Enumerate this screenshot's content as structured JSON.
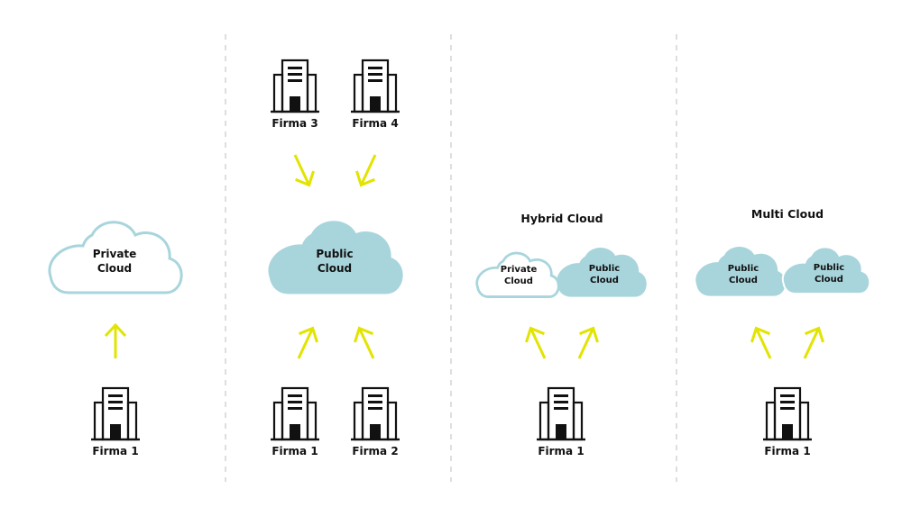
{
  "colors": {
    "cloud_fill": "#a8d5dc",
    "cloud_outline": "#a8d5dc",
    "arrow": "#e2e400",
    "building": "#111111",
    "divider": "#cccccc",
    "text": "#111111"
  },
  "sections": [
    {
      "id": "private",
      "title": "",
      "clouds": [
        {
          "type": "private",
          "label_line1": "Private",
          "label_line2": "Cloud"
        }
      ],
      "buildings_bottom": [
        "Firma 1"
      ],
      "buildings_top": []
    },
    {
      "id": "public",
      "title": "",
      "clouds": [
        {
          "type": "public",
          "label_line1": "Public",
          "label_line2": "Cloud"
        }
      ],
      "buildings_bottom": [
        "Firma 1",
        "Firma 2"
      ],
      "buildings_top": [
        "Firma 3",
        "Firma 4"
      ]
    },
    {
      "id": "hybrid",
      "title": "Hybrid Cloud",
      "clouds": [
        {
          "type": "private",
          "label_line1": "Private",
          "label_line2": "Cloud"
        },
        {
          "type": "public",
          "label_line1": "Public",
          "label_line2": "Cloud"
        }
      ],
      "buildings_bottom": [
        "Firma 1"
      ],
      "buildings_top": []
    },
    {
      "id": "multi",
      "title": "Multi Cloud",
      "clouds": [
        {
          "type": "public",
          "label_line1": "Public",
          "label_line2": "Cloud"
        },
        {
          "type": "public",
          "label_line1": "Public",
          "label_line2": "Cloud"
        }
      ],
      "buildings_bottom": [
        "Firma 1"
      ],
      "buildings_top": []
    }
  ]
}
